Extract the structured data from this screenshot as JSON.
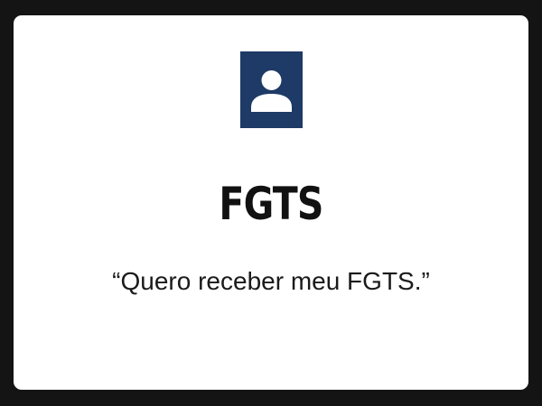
{
  "card": {
    "icon": "user-avatar-icon",
    "icon_bg_color": "#1e3a66",
    "title": "FGTS",
    "quote": "“Quero receber meu FGTS.”"
  }
}
